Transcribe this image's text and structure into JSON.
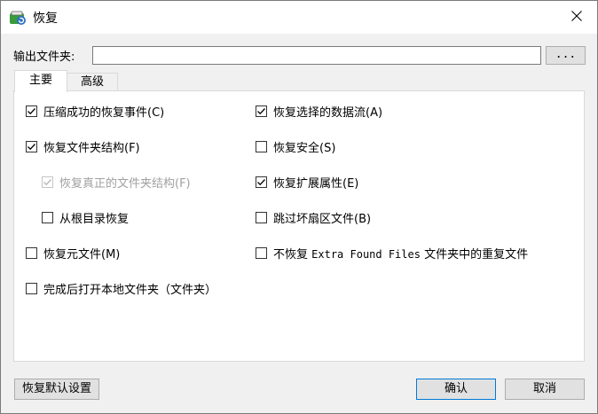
{
  "window": {
    "title": "恢复",
    "icon": "recovery-app-icon"
  },
  "output": {
    "label": "输出文件夹:",
    "value": "",
    "browse_label": "..."
  },
  "tabs": [
    {
      "label": "主要",
      "active": true
    },
    {
      "label": "高级",
      "active": false
    }
  ],
  "options": {
    "left": [
      {
        "label": "压缩成功的恢复事件(C)",
        "checked": true,
        "disabled": false
      },
      {
        "label": "恢复文件夹结构(F)",
        "checked": true,
        "disabled": false
      },
      {
        "label": "恢复真正的文件夹结构(F)",
        "checked": true,
        "disabled": true
      },
      {
        "label": "从根目录恢复",
        "checked": false,
        "disabled": false
      },
      {
        "label": "恢复元文件(M)",
        "checked": false,
        "disabled": false
      },
      {
        "label": "完成后打开本地文件夹（文件夹）",
        "checked": false,
        "disabled": false
      }
    ],
    "right": [
      {
        "label": "恢复选择的数据流(A)",
        "checked": true
      },
      {
        "label": "恢复安全(S)",
        "checked": false
      },
      {
        "label": "恢复扩展属性(E)",
        "checked": true
      },
      {
        "label": "跳过坏扇区文件(B)",
        "checked": false
      },
      {
        "label_pre": "不恢复 ",
        "label_mono": "Extra Found Files",
        "label_post": " 文件夹中的重复文件",
        "checked": false
      }
    ]
  },
  "buttons": {
    "restore_defaults": "恢复默认设置",
    "ok": "确认",
    "cancel": "取消"
  },
  "colors": {
    "accent": "#0078d7",
    "panel": "#ffffff",
    "dialog_bg": "#f0f0f0"
  }
}
